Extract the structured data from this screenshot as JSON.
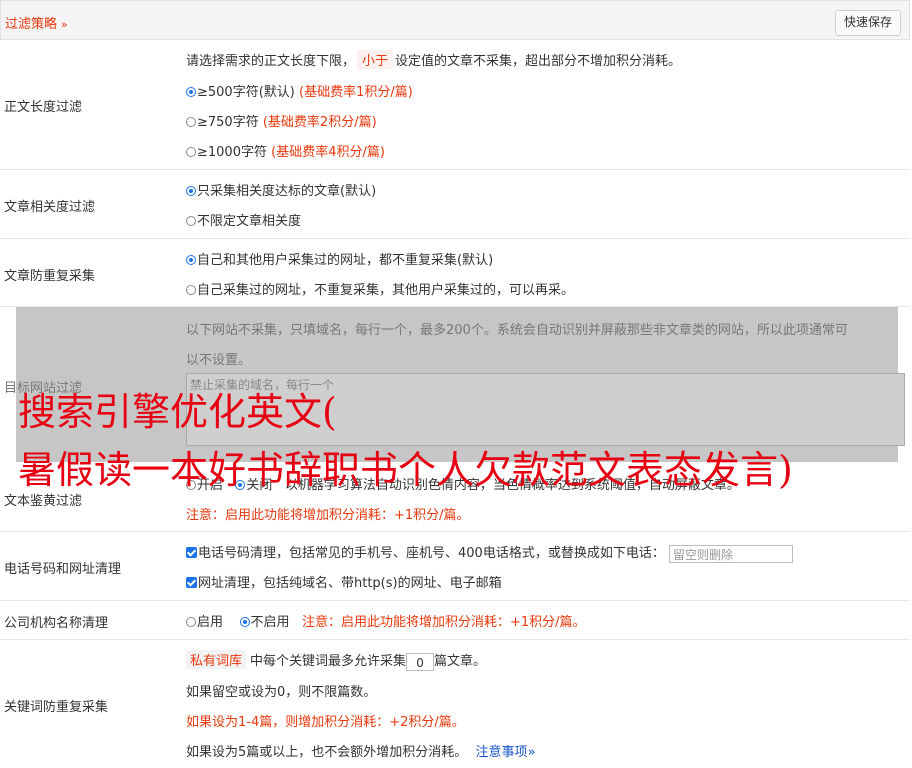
{
  "header": {
    "title": "过滤策略",
    "chevron": "»",
    "save_label": "快速保存"
  },
  "content_length": {
    "label": "正文长度过滤",
    "desc_before": "请选择需求的正文长度下限，",
    "desc_tag": "小于",
    "desc_after": "设定值的文章不采集，超出部分不增加积分消耗。",
    "options": [
      {
        "text": "≥500字符(默认)",
        "note": "(基础费率1积分/篇)"
      },
      {
        "text": "≥750字符",
        "note": "(基础费率2积分/篇)"
      },
      {
        "text": "≥1000字符",
        "note": "(基础费率4积分/篇)"
      }
    ]
  },
  "relevance": {
    "label": "文章相关度过滤",
    "options": [
      "只采集相关度达标的文章(默认)",
      "不限定文章相关度"
    ]
  },
  "dedup": {
    "label": "文章防重复采集",
    "options": [
      "自己和其他用户采集过的网址，都不重复采集(默认)",
      "自己采集过的网址，不重复采集，其他用户采集过的，可以再采。"
    ]
  },
  "site_filter": {
    "label": "目标网站过滤",
    "desc_line1": "以下网站不采集，只填域名，每行一个，最多200个。系统会自动识别并屏蔽那些非文章类的网站，所以此项通常可",
    "desc_line2": "以不设置。",
    "placeholder": "禁止采集的域名，每行一个"
  },
  "porn_filter": {
    "label": "文本鉴黄过滤",
    "opt_on": "开启",
    "opt_off": "关闭",
    "desc": "以机器学习算法自动识别色情内容，当色情概率达到系统阈值，自动屏蔽文章。",
    "note": "注意：启用此功能将增加积分消耗：+1积分/篇。"
  },
  "phone_clean": {
    "label": "电话号码和网址清理",
    "phone_text": "电话号码清理，包括常见的手机号、座机号、400电话格式，或替换成如下电话：",
    "phone_placeholder": "留空则删除",
    "url_text": "网址清理，包括纯域名、带http(s)的网址、电子邮箱"
  },
  "org_clean": {
    "label": "公司机构名称清理",
    "opt_on": "启用",
    "opt_off": "不启用",
    "note": "注意：启用此功能将增加积分消耗：+1积分/篇。"
  },
  "keyword_dedup": {
    "label": "关键词防重复采集",
    "tag": "私有词库",
    "line1_a": "中每个关键词最多允许采集",
    "value": "0",
    "line1_b": "篇文章。",
    "line2": "如果留空或设为0，则不限篇数。",
    "line3": "如果设为1-4篇，则增加积分消耗：+2积分/篇。",
    "line4": "如果设为5篇或以上，也不会额外增加积分消耗。",
    "link": "注意事项",
    "link_chevron": "»"
  },
  "watermark": {
    "line1": "搜索引擎优化英文(",
    "line2": "暑假读一本好书辞职书个人欠款范文表态发言)"
  }
}
